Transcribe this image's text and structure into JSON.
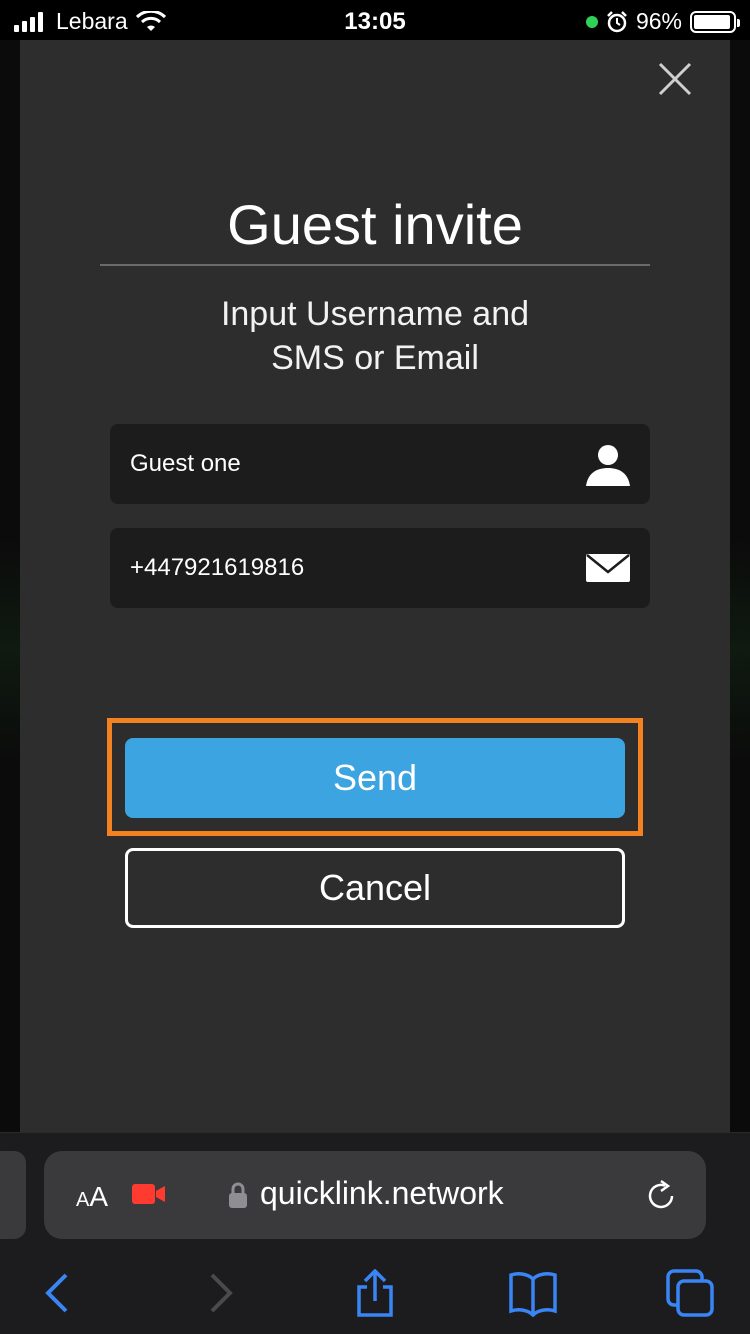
{
  "status": {
    "carrier": "Lebara",
    "time": "13:05",
    "battery": "96%",
    "battery_level": 0.96
  },
  "modal": {
    "title": "Guest invite",
    "instruction_line1": "Input Username and",
    "instruction_line2": "SMS or Email",
    "username_value": "Guest one",
    "contact_value": "+447921619816",
    "send_label": "Send",
    "cancel_label": "Cancel",
    "icons": [
      "close-icon",
      "user-icon",
      "envelope-icon"
    ]
  },
  "browser": {
    "aa_large": "A",
    "aa_small": "A",
    "url": "quicklink.network",
    "icons": [
      "text-size-icon",
      "video-record-icon",
      "lock-icon",
      "reload-icon",
      "back-icon",
      "forward-icon",
      "share-icon",
      "bookmarks-icon",
      "tabs-icon"
    ]
  },
  "colors": {
    "modal_bg": "#2d2d2e",
    "send_button": "#3ca4e0",
    "highlight_outline": "#f58220",
    "browser_accent": "#3a85f5",
    "record_red": "#ff3b30"
  }
}
